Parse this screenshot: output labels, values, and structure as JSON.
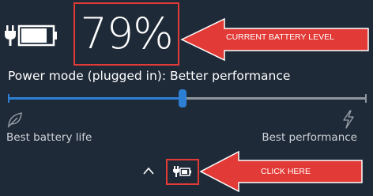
{
  "battery": {
    "percentage": "79%",
    "icon": "battery-charging-icon",
    "level_percent": 79
  },
  "annotations": {
    "current_battery_level": "CURRENT BATTERY LEVEL",
    "click_here": "CLICK HERE",
    "arrow_color": "#e23a36",
    "box_color": "#e23a36"
  },
  "power_mode": {
    "label": "Power mode (plugged in): Better performance",
    "slider_value_percent": 49,
    "min_label": "Best battery life",
    "max_label": "Best performance",
    "min_icon": "leaf-icon",
    "max_icon": "lightning-bolt-icon",
    "accent_color": "#2d7fd4"
  },
  "taskbar": {
    "chevron_icon": "chevron-up-icon",
    "tray_icon": "battery-charging-icon"
  },
  "colors": {
    "background": "#1f2a38"
  }
}
